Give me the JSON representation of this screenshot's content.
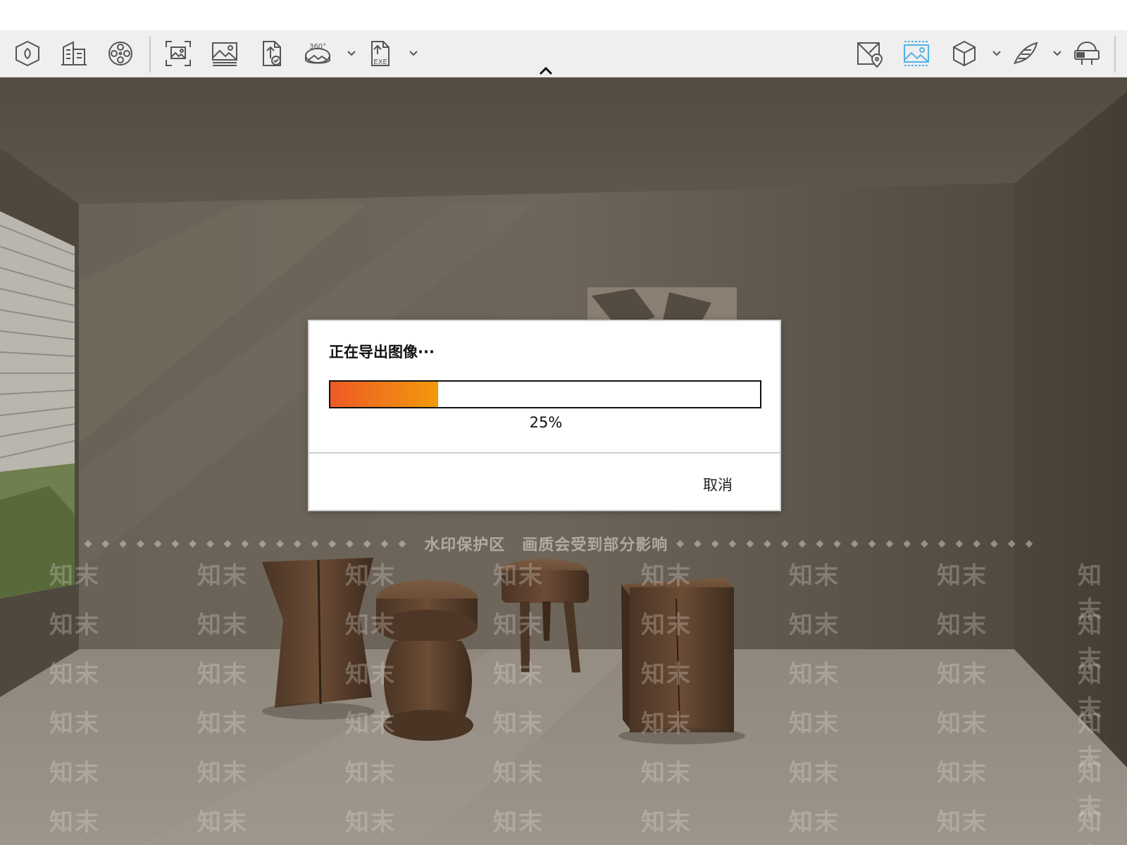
{
  "toolbar": {
    "left_tools": [
      {
        "name": "render-icon"
      },
      {
        "name": "building-icon"
      },
      {
        "name": "film-reel-icon"
      },
      {
        "name": "capture-frame-icon"
      },
      {
        "name": "image-icon"
      },
      {
        "name": "export-file-icon"
      },
      {
        "name": "panorama-360-icon",
        "label": "360°",
        "has_dropdown": true
      },
      {
        "name": "export-exe-icon",
        "label": "EXE",
        "has_dropdown": true
      }
    ],
    "right_tools": [
      {
        "name": "map-pin-icon"
      },
      {
        "name": "image-active-icon",
        "active": true
      },
      {
        "name": "cube-icon",
        "has_dropdown": true
      },
      {
        "name": "feather-icon",
        "has_dropdown": true
      },
      {
        "name": "vr-headset-icon"
      }
    ],
    "active_color": "#4fb3e8"
  },
  "watermark": {
    "band_text_1": "水印保护区",
    "band_text_2": "画质会受到部分影响",
    "logo_text": "知末"
  },
  "dialog": {
    "title": "正在导出图像···",
    "progress_percent": 25,
    "progress_label": "25%",
    "cancel_label": "取消",
    "fill_start_color": "#ee5a24",
    "fill_end_color": "#f29a0c"
  }
}
